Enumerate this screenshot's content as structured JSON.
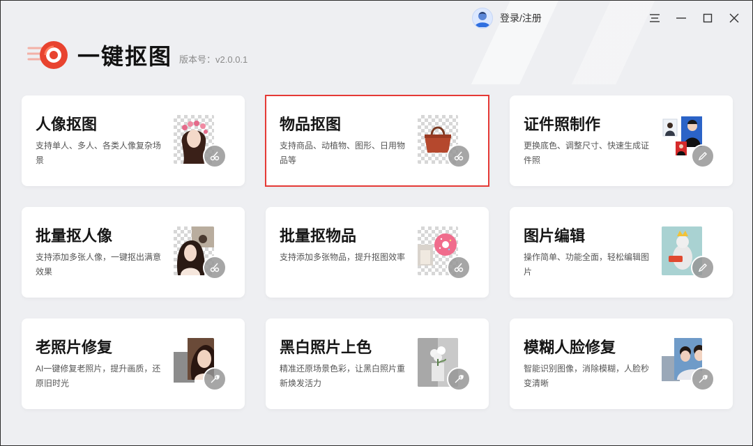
{
  "header": {
    "user_label": "登录/注册",
    "app_title": "一键抠图",
    "version": "版本号：v2.0.0.1"
  },
  "window_controls": [
    "menu-icon",
    "minimize-icon",
    "maximize-icon",
    "close-icon"
  ],
  "colors": {
    "accent": "#e8432f",
    "selection": "#e53935"
  },
  "cards": [
    {
      "title": "人像抠图",
      "desc": "支持单人、多人、各类人像复杂场景",
      "icon": "scissors-icon",
      "selected": false
    },
    {
      "title": "物品抠图",
      "desc": "支持商品、动植物、图形、日用物品等",
      "icon": "scissors-icon",
      "selected": true
    },
    {
      "title": "证件照制作",
      "desc": "更换底色、调整尺寸、快速生成证件照",
      "icon": "pencil-icon",
      "selected": false
    },
    {
      "title": "批量抠人像",
      "desc": "支持添加多张人像，一键抠出满意效果",
      "icon": "scissors-icon",
      "selected": false
    },
    {
      "title": "批量抠物品",
      "desc": "支持添加多张物品，提升抠图效率",
      "icon": "scissors-icon",
      "selected": false
    },
    {
      "title": "图片编辑",
      "desc": "操作简单、功能全面，轻松编辑图片",
      "icon": "pencil-icon",
      "selected": false
    },
    {
      "title": "老照片修复",
      "desc": "AI一键修复老照片，提升画质，还原旧时光",
      "icon": "wrench-icon",
      "selected": false
    },
    {
      "title": "黑白照片上色",
      "desc": "精准还原场景色彩，让黑白照片重新焕发活力",
      "icon": "wrench-icon",
      "selected": false
    },
    {
      "title": "模糊人脸修复",
      "desc": "智能识别图像，消除模糊，人脸秒变清晰",
      "icon": "wrench-icon",
      "selected": false
    }
  ]
}
